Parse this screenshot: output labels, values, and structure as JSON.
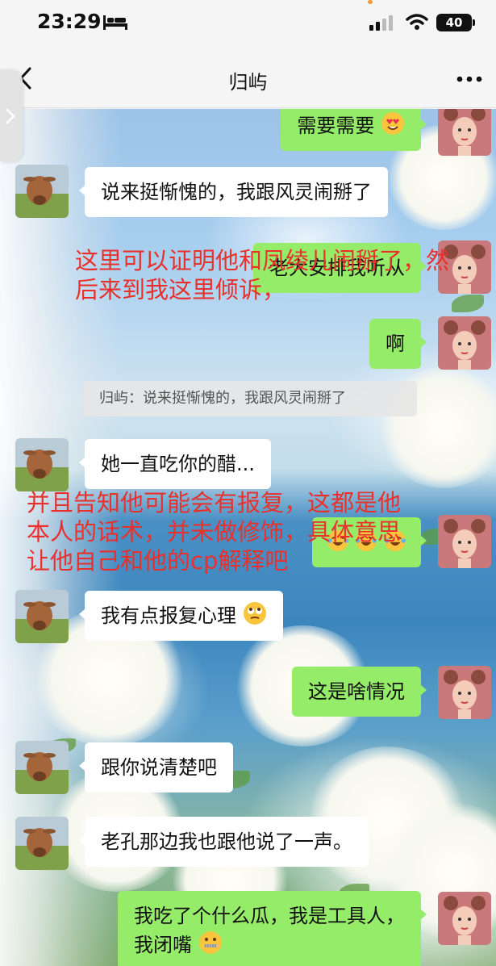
{
  "status_bar": {
    "time": "23:29",
    "battery": "40"
  },
  "nav": {
    "title": "归屿"
  },
  "quote_text": "归屿：说来挺惭愧的，我跟风灵闹掰了",
  "messages": {
    "m1": "需要需要",
    "m2": "说来挺惭愧的，我跟风灵闹掰了",
    "m3": "老大安排我听从",
    "m4": "啊",
    "m5": "她一直吃你的醋...",
    "m7": "我有点报复心理",
    "m8": "这是啥情况",
    "m9": "跟你说清楚吧",
    "m10": "老孔那边我也跟他说了一声。",
    "m11_line1": "我吃了个什么瓜，我是工具人，",
    "m11_line2": "我闭嘴"
  },
  "annotations": {
    "a1_line1": "这里可以证明他和凤绫儿闹掰了，然",
    "a1_line2": "后来到我这里倾诉，",
    "a2_line1": "并且告知他可能会有报复，这都是他",
    "a2_line2": "本人的话术，并未做修饰，具体意思",
    "a2_line3": "让他自己和他的cp解释吧"
  },
  "icons": {
    "bed": "bed-icon",
    "signal": "signal-icon",
    "wifi": "wifi-icon",
    "back": "chevron-left-icon",
    "more": "more-dots-icon",
    "side": "chevron-right-icon",
    "e1": "heart-eyes-emoji",
    "e2": "rolling-eyes-emoji",
    "e3": "laughing-tears-emoji",
    "e4": "zipper-mouth-emoji"
  },
  "colors": {
    "green_bubble": "#95ec69",
    "white_bubble": "#ffffff",
    "annotation": "#e8312d"
  }
}
